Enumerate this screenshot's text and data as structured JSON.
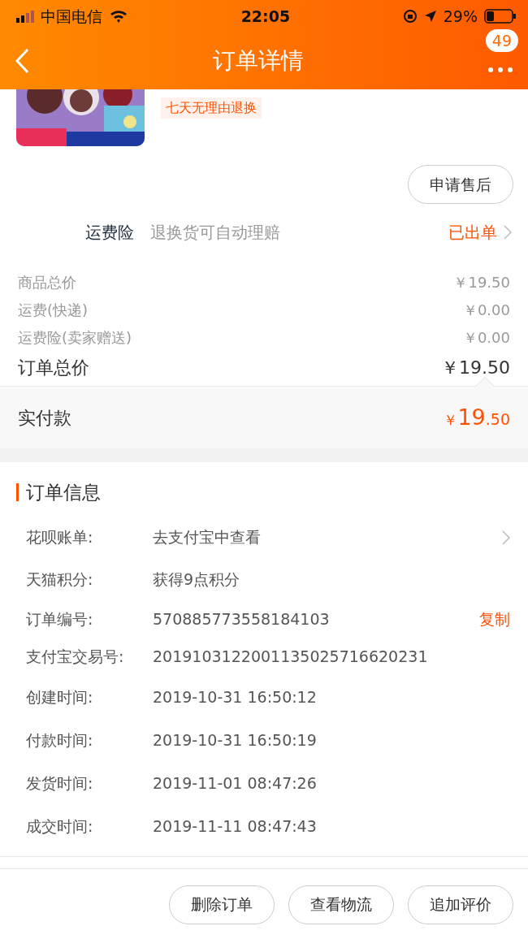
{
  "status_bar": {
    "carrier": "中国电信",
    "time": "22:05",
    "battery": "29%"
  },
  "nav": {
    "title": "订单详情",
    "badge": "49"
  },
  "product": {
    "kind": "picture",
    "tag": "七天无理由退换"
  },
  "after_sale_button": "申请售后",
  "insurance": {
    "label": "运费险",
    "description": "退换货可自动理赔",
    "status": "已出单"
  },
  "price_rows": [
    {
      "kind": "minor",
      "label": "商品总价",
      "value": "￥19.50"
    },
    {
      "kind": "minor",
      "label": "运费(快递)",
      "value": "￥0.00"
    },
    {
      "kind": "minor",
      "label": "运费险(卖家赠送)",
      "value": "￥0.00"
    },
    {
      "kind": "total",
      "label": "订单总价",
      "value": "￥19.50"
    }
  ],
  "paid": {
    "label": "实付款",
    "currency": "￥",
    "integer": "19",
    "decimal": ".50"
  },
  "order_info": {
    "title": "订单信息",
    "rows": [
      {
        "kind": "link",
        "label": "花呗账单:",
        "value": "去支付宝中查看"
      },
      {
        "kind": "plain",
        "label": "天猫积分:",
        "value": "获得9点积分"
      },
      {
        "kind": "copy",
        "label": "订单编号:",
        "value": "570885773558184103",
        "action": "复制"
      },
      {
        "kind": "plain",
        "label": "支付宝交易号:",
        "value": "2019103122001135025716620231"
      },
      {
        "kind": "plain",
        "label": "创建时间:",
        "value": "2019-10-31 16:50:12"
      },
      {
        "kind": "plain",
        "label": "付款时间:",
        "value": "2019-10-31 16:50:19"
      },
      {
        "kind": "plain",
        "label": "发货时间:",
        "value": "2019-11-01 08:47:26"
      },
      {
        "kind": "plain",
        "label": "成交时间:",
        "value": "2019-11-11 08:47:43"
      }
    ]
  },
  "buttons": [
    "删除订单",
    "查看物流",
    "追加评价"
  ]
}
